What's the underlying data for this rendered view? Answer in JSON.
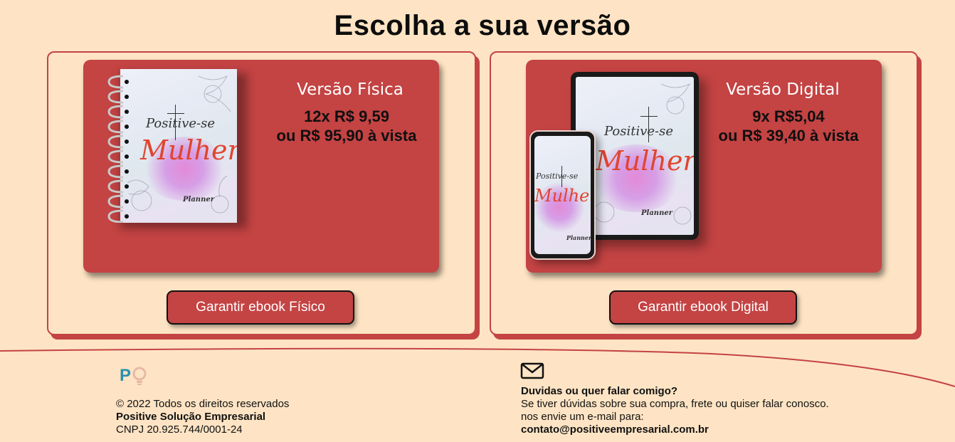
{
  "page": {
    "heading": "Escolha a sua versão"
  },
  "physical": {
    "title": "Versão Física",
    "installments": "12x R$ 9,59",
    "cash": "ou R$ 95,90 à vista",
    "button": "Garantir ebook Físico",
    "cover": {
      "line1": "Positive-se",
      "line2": "Mulher",
      "line3": "Planner"
    }
  },
  "digital": {
    "title": "Versão Digital",
    "installments": "9x R$5,04",
    "cash": "ou R$ 39,40 à vista",
    "button": "Garantir ebook Digital",
    "cover": {
      "line1": "Positive-se",
      "line2": "Mulher",
      "line3": "Planner"
    }
  },
  "footer": {
    "logo_text": "P",
    "copyright": "© 2022 Todos os direitos reservados",
    "company": "Positive Solução Empresarial",
    "cnpj": "CNPJ 20.925.744/0001-24",
    "contact_icon": "mail-icon",
    "contact_heading": "Duvidas ou quer falar comigo?",
    "contact_line1": "Se tiver dúvidas sobre sua compra, frete ou quiser falar conosco.",
    "contact_line2": "nos envie um e-mail para:",
    "email": "contato@positiveempresarial.com.br"
  },
  "colors": {
    "background": "#FEE4C4",
    "accent": "#C44343",
    "logo_blue": "#2A8FB0"
  }
}
